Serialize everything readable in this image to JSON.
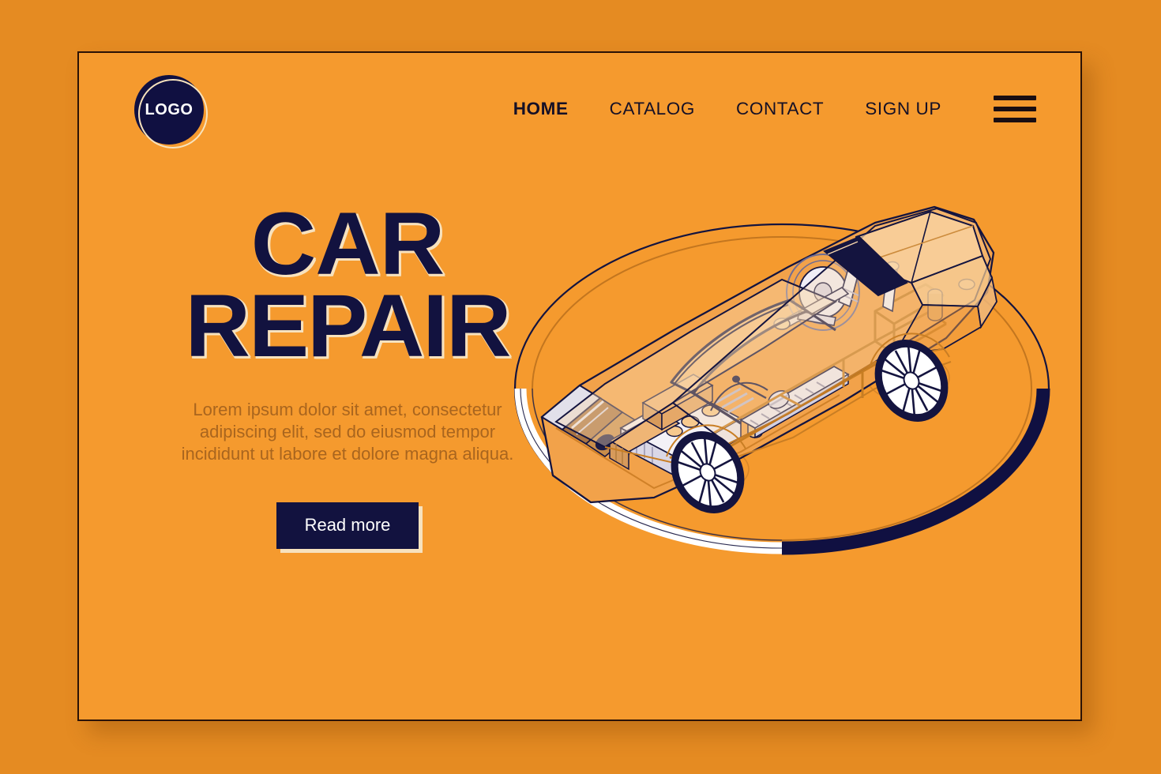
{
  "theme": {
    "page_bg": "#E58B22",
    "card_bg": "#F59A2E",
    "ink": "#12123F",
    "cream": "#F7E2BE",
    "muted_text": "#A9651E",
    "card_border": "#2B1206"
  },
  "header": {
    "logo": {
      "text": "LOGO",
      "shape": "circle"
    },
    "nav": {
      "items": [
        {
          "label": "HOME",
          "active": true
        },
        {
          "label": "CATALOG",
          "active": false
        },
        {
          "label": "CONTACT",
          "active": false
        },
        {
          "label": "SIGN UP",
          "active": false
        }
      ],
      "menu_icon": "hamburger-icon"
    }
  },
  "hero": {
    "headline_line_1": "CAR",
    "headline_line_2": "REPAIR",
    "paragraph": "Lorem ipsum dolor sit amet, consectetur adipiscing elit, sed do eiusmod tempor incididunt ut labore et dolore magna aliqua.",
    "cta_label": "Read more"
  },
  "illustration": {
    "name": "isometric-cutaway-car",
    "description": "Isometric line-art cutaway sports car on an elliptical platform showing engine, chassis, suspension and wheels",
    "platform_arc_light": "#FFFFFF",
    "platform_arc_dark": "#101041",
    "body_tint": "#F7C98E",
    "body_tint_2": "#FAD9AE",
    "glass_tint": "#FBDCB2",
    "metal": "#F2F0F6",
    "outline": "#12123F",
    "outline_warm": "#C67A22"
  }
}
